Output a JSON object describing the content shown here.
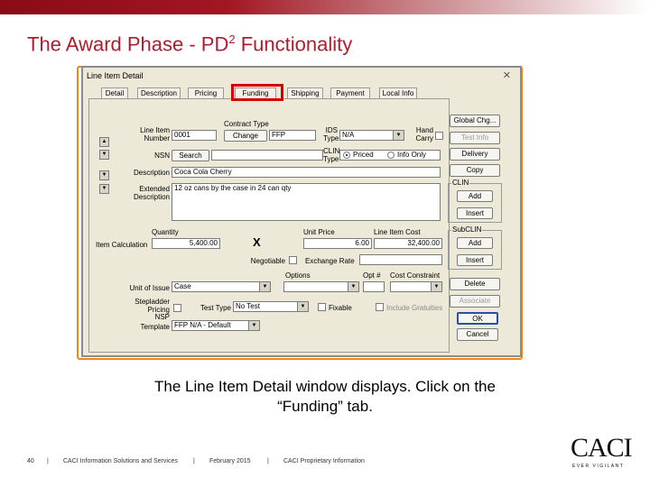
{
  "slide": {
    "title": "The Award Phase - PD",
    "title_sup": "2",
    "title_suffix": " Functionality",
    "caption_line1": "The Line Item Detail window displays.  Click on the",
    "caption_line2": "“Funding” tab.",
    "accent_color": "#b01c2e",
    "highlight_color": "#d40000"
  },
  "window": {
    "title": "Line Item Detail",
    "close_glyph": "✕",
    "tabs": [
      "Detail",
      "Description",
      "Pricing",
      "Funding",
      "Shipping",
      "Payment",
      "Local Info"
    ],
    "labels": {
      "line_item_number": "Line Item\nNumber",
      "contract_type": "Contract Type",
      "ids_type": "IDS\nType",
      "hand_carry": "Hand\nCarry",
      "nsn": "NSN",
      "clin_type": "CLIN\nType",
      "description": "Description",
      "extended_description": "Extended\nDescription",
      "quantity": "Quantity",
      "unit_price": "Unit Price",
      "line_item_cost": "Line Item Cost",
      "item_calculation": "Item Calculation",
      "negotiable": "Negotiable",
      "exchange_rate": "Exchange Rate",
      "options": "Options",
      "opt_num": "Opt #",
      "cost_constraint": "Cost Constraint",
      "unit_of_issue": "Unit of Issue",
      "stepladder_pricing": "Stepladder\nPricing",
      "test_type": "Test Type",
      "fixable": "Fixable",
      "include_gratuities": "Include Gratuities",
      "nsp": "NSP",
      "template": "Template",
      "clin_group": "CLIN",
      "subclin_group": "SubCLIN"
    },
    "values": {
      "line_item_number": "0001",
      "contract_type": "FFP",
      "ids_type": "N/A",
      "description": "Coca Cola Cherry",
      "extended_description": "12 oz cans by the case in 24 can qty",
      "quantity": "5,400.00",
      "unit_price": "6.00",
      "line_item_cost": "32,400.00",
      "unit_of_issue": "Case",
      "test_type": "No Test",
      "template": "FFP N/A - Default",
      "x_mark": "X"
    },
    "radio": {
      "priced": "Priced",
      "info_only": "Info Only"
    },
    "buttons": {
      "change": "Change",
      "search": "Search",
      "global_chg": "Global Chg...",
      "test_info": "Test Info",
      "delivery": "Delivery",
      "copy": "Copy",
      "clin_add": "Add",
      "clin_insert": "Insert",
      "subclin_add": "Add",
      "subclin_insert": "Insert",
      "delete": "Delete",
      "associate": "Associate",
      "ok": "OK",
      "cancel": "Cancel"
    }
  },
  "footer": {
    "page_number": "40",
    "sep": "|",
    "company": "CACI Information Solutions and Services",
    "date": "February 2015",
    "proprietary": "CACI Proprietary Information"
  },
  "logo": {
    "name": "CACI",
    "tagline": "EVER VIGILANT"
  }
}
